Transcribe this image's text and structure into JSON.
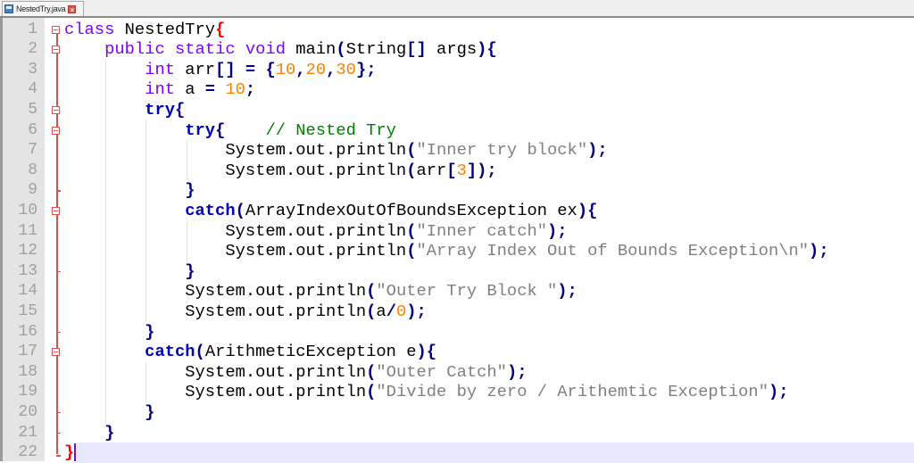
{
  "tab": {
    "file_name": "NestedTry.java",
    "close_icon": "close-icon",
    "file_icon": "save-disk-icon"
  },
  "editor": {
    "current_line": 22,
    "lines": [
      {
        "n": "1",
        "fold": "box",
        "tokens": [
          [
            "kw",
            "class"
          ],
          [
            "id",
            " NestedTry"
          ],
          [
            "red",
            "{"
          ]
        ]
      },
      {
        "n": "2",
        "fold": "box",
        "tokens": [
          [
            "id",
            "    "
          ],
          [
            "kw",
            "public static void"
          ],
          [
            "id",
            " main"
          ],
          [
            "op",
            "("
          ],
          [
            "id",
            "String"
          ],
          [
            "op",
            "[]"
          ],
          [
            "id",
            " args"
          ],
          [
            "op",
            "){"
          ]
        ]
      },
      {
        "n": "3",
        "fold": "line",
        "tokens": [
          [
            "id",
            "        "
          ],
          [
            "kw",
            "int"
          ],
          [
            "id",
            " arr"
          ],
          [
            "op",
            "[]"
          ],
          [
            "id",
            " "
          ],
          [
            "op",
            "="
          ],
          [
            "id",
            " "
          ],
          [
            "op",
            "{"
          ],
          [
            "num",
            "10"
          ],
          [
            "op",
            ","
          ],
          [
            "num",
            "20"
          ],
          [
            "op",
            ","
          ],
          [
            "num",
            "30"
          ],
          [
            "op",
            "};"
          ]
        ]
      },
      {
        "n": "4",
        "fold": "line",
        "tokens": [
          [
            "id",
            "        "
          ],
          [
            "kw",
            "int"
          ],
          [
            "id",
            " a "
          ],
          [
            "op",
            "="
          ],
          [
            "id",
            " "
          ],
          [
            "num",
            "10"
          ],
          [
            "op",
            ";"
          ]
        ]
      },
      {
        "n": "5",
        "fold": "box",
        "tokens": [
          [
            "id",
            "        "
          ],
          [
            "kb",
            "try"
          ],
          [
            "op",
            "{"
          ]
        ]
      },
      {
        "n": "6",
        "fold": "box",
        "tokens": [
          [
            "id",
            "            "
          ],
          [
            "kb",
            "try"
          ],
          [
            "op",
            "{"
          ],
          [
            "id",
            "    "
          ],
          [
            "cmt",
            "// Nested Try"
          ]
        ]
      },
      {
        "n": "7",
        "fold": "line",
        "tokens": [
          [
            "id",
            "                System.out.println"
          ],
          [
            "op",
            "("
          ],
          [
            "str",
            "\"Inner try block\""
          ],
          [
            "op",
            ");"
          ]
        ]
      },
      {
        "n": "8",
        "fold": "line",
        "tokens": [
          [
            "id",
            "                System.out.println"
          ],
          [
            "op",
            "("
          ],
          [
            "id",
            "arr"
          ],
          [
            "op",
            "["
          ],
          [
            "num",
            "3"
          ],
          [
            "op",
            "]);"
          ]
        ]
      },
      {
        "n": "9",
        "fold": "tick",
        "tokens": [
          [
            "id",
            "            "
          ],
          [
            "op",
            "}"
          ]
        ]
      },
      {
        "n": "10",
        "fold": "box",
        "tokens": [
          [
            "id",
            "            "
          ],
          [
            "kb",
            "catch"
          ],
          [
            "op",
            "("
          ],
          [
            "id",
            "ArrayIndexOutOfBoundsException ex"
          ],
          [
            "op",
            "){"
          ]
        ]
      },
      {
        "n": "11",
        "fold": "line",
        "tokens": [
          [
            "id",
            "                System.out.println"
          ],
          [
            "op",
            "("
          ],
          [
            "str",
            "\"Inner catch\""
          ],
          [
            "op",
            ");"
          ]
        ]
      },
      {
        "n": "12",
        "fold": "line",
        "tokens": [
          [
            "id",
            "                System.out.println"
          ],
          [
            "op",
            "("
          ],
          [
            "str",
            "\"Array Index Out of Bounds Exception\\n\""
          ],
          [
            "op",
            ");"
          ]
        ]
      },
      {
        "n": "13",
        "fold": "tick",
        "tokens": [
          [
            "id",
            "            "
          ],
          [
            "op",
            "}"
          ]
        ]
      },
      {
        "n": "14",
        "fold": "line",
        "tokens": [
          [
            "id",
            "            System.out.println"
          ],
          [
            "op",
            "("
          ],
          [
            "str",
            "\"Outer Try Block \""
          ],
          [
            "op",
            ");"
          ]
        ]
      },
      {
        "n": "15",
        "fold": "line",
        "tokens": [
          [
            "id",
            "            System.out.println"
          ],
          [
            "op",
            "("
          ],
          [
            "id",
            "a"
          ],
          [
            "op",
            "/"
          ],
          [
            "num",
            "0"
          ],
          [
            "op",
            ");"
          ]
        ]
      },
      {
        "n": "16",
        "fold": "tick",
        "tokens": [
          [
            "id",
            "        "
          ],
          [
            "op",
            "}"
          ]
        ]
      },
      {
        "n": "17",
        "fold": "box",
        "tokens": [
          [
            "id",
            "        "
          ],
          [
            "kb",
            "catch"
          ],
          [
            "op",
            "("
          ],
          [
            "id",
            "ArithmeticException e"
          ],
          [
            "op",
            "){"
          ]
        ]
      },
      {
        "n": "18",
        "fold": "line",
        "tokens": [
          [
            "id",
            "            System.out.println"
          ],
          [
            "op",
            "("
          ],
          [
            "str",
            "\"Outer Catch\""
          ],
          [
            "op",
            ");"
          ]
        ]
      },
      {
        "n": "19",
        "fold": "line",
        "tokens": [
          [
            "id",
            "            System.out.println"
          ],
          [
            "op",
            "("
          ],
          [
            "str",
            "\"Divide by zero / Arithemtic Exception\""
          ],
          [
            "op",
            ");"
          ]
        ]
      },
      {
        "n": "20",
        "fold": "tick",
        "tokens": [
          [
            "id",
            "        "
          ],
          [
            "op",
            "}"
          ]
        ]
      },
      {
        "n": "21",
        "fold": "tick",
        "tokens": [
          [
            "id",
            "    "
          ],
          [
            "op",
            "}"
          ]
        ]
      },
      {
        "n": "22",
        "fold": "end",
        "tokens": [
          [
            "red",
            "}"
          ]
        ]
      }
    ]
  }
}
